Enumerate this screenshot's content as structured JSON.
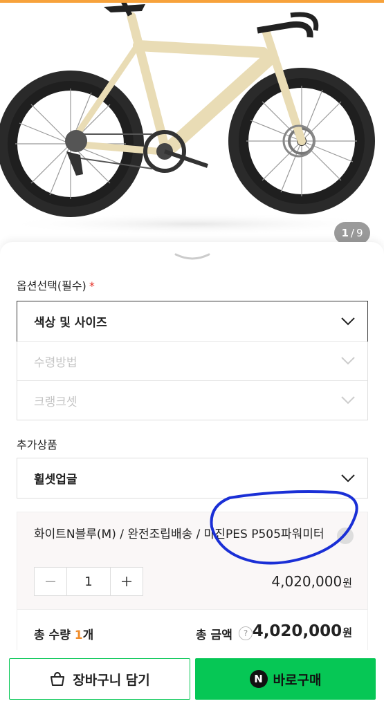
{
  "gallery": {
    "current": "1",
    "separator": "/",
    "total": "9"
  },
  "options": {
    "label": "옵션선택(필수)",
    "required_mark": "*",
    "items": [
      {
        "label": "색상 및 사이즈"
      },
      {
        "label": "수령방법"
      },
      {
        "label": "크랭크셋"
      }
    ]
  },
  "addons": {
    "label": "추가상품",
    "items": [
      {
        "label": "휠셋업글"
      }
    ]
  },
  "selected_item": {
    "title": "화이트N블루(M) / 완전조립배송 / 마진PES P505파워미터",
    "quantity": "1",
    "price": "4,020,000",
    "currency": "원"
  },
  "summary": {
    "qty_label": "총 수량 ",
    "qty_value": "1",
    "qty_unit": "개",
    "total_label": "총 금액",
    "help": "?",
    "total_price": "4,020,000",
    "currency": "원"
  },
  "actions": {
    "cart_label": "장바구니 담기",
    "buy_label": "바로구매",
    "buy_badge": "N"
  },
  "colors": {
    "accent": "#06c755",
    "top_bar": "#f7a23b",
    "required": "#e5332a",
    "annotation": "#1a2fd6"
  }
}
